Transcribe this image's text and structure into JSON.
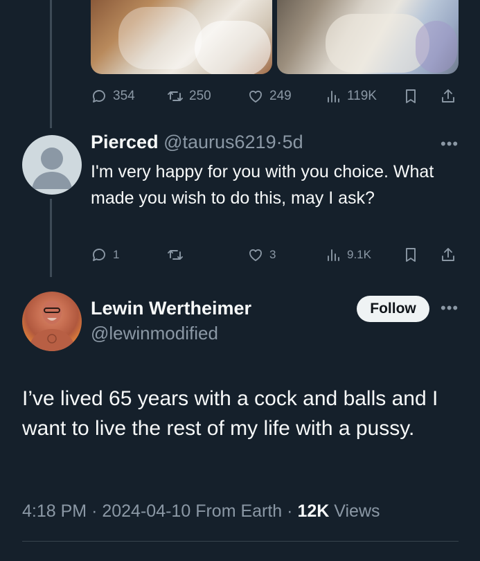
{
  "previous_tweet": {
    "stats": {
      "replies": "354",
      "retweets": "250",
      "likes": "249",
      "views": "119K"
    }
  },
  "reply": {
    "display_name": "Pierced",
    "handle": "@taurus6219",
    "separator": "·",
    "age": "5d",
    "text": "I'm very happy for you with you choice. What made you wish to do this, may I ask?",
    "stats": {
      "replies": "1",
      "retweets": "",
      "likes": "3",
      "views": "9.1K"
    }
  },
  "main_tweet": {
    "display_name": "Lewin Wertheimer",
    "handle": "@lewinmodified",
    "follow_label": "Follow",
    "text": "I’ve lived 65 years with a cock and balls and I want to live the rest of my life with a pussy.",
    "time": "4:18 PM",
    "date": "2024-04-10",
    "source": "From Earth",
    "views_count": "12K",
    "views_label": "Views"
  },
  "icons": {
    "reply": "reply-icon",
    "retweet": "retweet-icon",
    "like": "heart-icon",
    "views": "views-chart-icon",
    "bookmark": "bookmark-icon",
    "share": "share-icon",
    "more": "more-icon"
  },
  "colors": {
    "background": "#15202b",
    "text_primary": "#f7f9f9",
    "text_secondary": "#8b98a5",
    "follow_bg": "#eff3f4"
  }
}
